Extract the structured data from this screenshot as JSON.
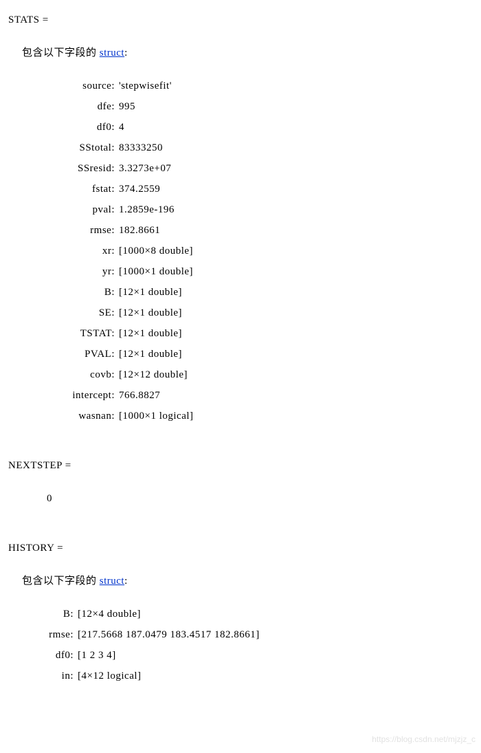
{
  "stats": {
    "header": "STATS =",
    "desc_prefix": "包含以下字段的 ",
    "struct_link": "struct",
    "desc_suffix": ":",
    "fields": [
      {
        "key": "source:",
        "val": "'stepwisefit'"
      },
      {
        "key": "dfe:",
        "val": "995"
      },
      {
        "key": "df0:",
        "val": "4"
      },
      {
        "key": "SStotal:",
        "val": "83333250"
      },
      {
        "key": "SSresid:",
        "val": "3.3273e+07"
      },
      {
        "key": "fstat:",
        "val": "374.2559"
      },
      {
        "key": "pval:",
        "val": "1.2859e-196"
      },
      {
        "key": "rmse:",
        "val": "182.8661"
      },
      {
        "key": "xr:",
        "val": "[1000×8 double]"
      },
      {
        "key": "yr:",
        "val": "[1000×1 double]"
      },
      {
        "key": "B:",
        "val": "[12×1 double]"
      },
      {
        "key": "SE:",
        "val": "[12×1 double]"
      },
      {
        "key": "TSTAT:",
        "val": "[12×1 double]"
      },
      {
        "key": "PVAL:",
        "val": "[12×1 double]"
      },
      {
        "key": "covb:",
        "val": "[12×12 double]"
      },
      {
        "key": "intercept:",
        "val": "766.8827"
      },
      {
        "key": "wasnan:",
        "val": "[1000×1 logical]"
      }
    ]
  },
  "nextstep": {
    "header": "NEXTSTEP =",
    "value": "0"
  },
  "history": {
    "header": "HISTORY =",
    "desc_prefix": "包含以下字段的 ",
    "struct_link": "struct",
    "desc_suffix": ":",
    "fields": [
      {
        "key": "B:",
        "val": "[12×4 double]"
      },
      {
        "key": "rmse:",
        "val": "[217.5668 187.0479 183.4517 182.8661]"
      },
      {
        "key": "df0:",
        "val": "[1 2 3 4]"
      },
      {
        "key": "in:",
        "val": "[4×12 logical]"
      }
    ]
  },
  "watermark": "https://blog.csdn.net/mjzjz_c"
}
